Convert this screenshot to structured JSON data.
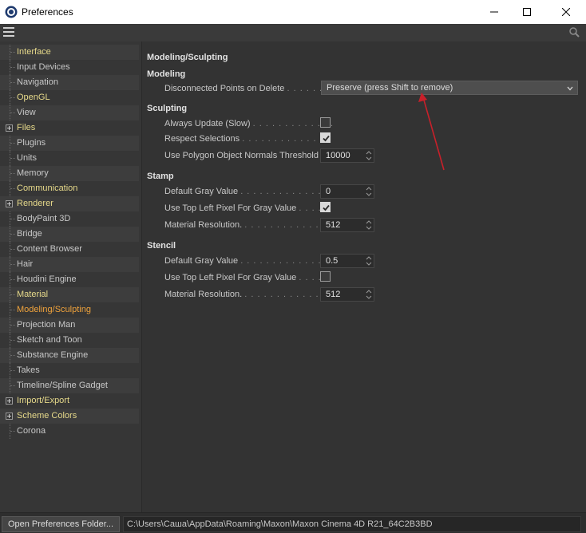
{
  "window": {
    "title": "Preferences"
  },
  "sidebar": {
    "items": [
      {
        "label": "Interface",
        "color": "yellow",
        "expandable": false
      },
      {
        "label": "Input Devices",
        "color": "gray",
        "expandable": false
      },
      {
        "label": "Navigation",
        "color": "gray",
        "expandable": false
      },
      {
        "label": "OpenGL",
        "color": "yellow",
        "expandable": false
      },
      {
        "label": "View",
        "color": "gray",
        "expandable": false
      },
      {
        "label": "Files",
        "color": "yellow",
        "expandable": true
      },
      {
        "label": "Plugins",
        "color": "gray",
        "expandable": false
      },
      {
        "label": "Units",
        "color": "gray",
        "expandable": false
      },
      {
        "label": "Memory",
        "color": "gray",
        "expandable": false
      },
      {
        "label": "Communication",
        "color": "yellow",
        "expandable": false
      },
      {
        "label": "Renderer",
        "color": "yellow",
        "expandable": true
      },
      {
        "label": "BodyPaint 3D",
        "color": "gray",
        "expandable": false
      },
      {
        "label": "Bridge",
        "color": "gray",
        "expandable": false
      },
      {
        "label": "Content Browser",
        "color": "gray",
        "expandable": false
      },
      {
        "label": "Hair",
        "color": "gray",
        "expandable": false
      },
      {
        "label": "Houdini Engine",
        "color": "gray",
        "expandable": false
      },
      {
        "label": "Material",
        "color": "yellow",
        "expandable": false
      },
      {
        "label": "Modeling/Sculpting",
        "color": "active",
        "expandable": false
      },
      {
        "label": "Projection Man",
        "color": "gray",
        "expandable": false
      },
      {
        "label": "Sketch and Toon",
        "color": "gray",
        "expandable": false
      },
      {
        "label": "Substance Engine",
        "color": "gray",
        "expandable": false
      },
      {
        "label": "Takes",
        "color": "gray",
        "expandable": false
      },
      {
        "label": "Timeline/Spline Gadget",
        "color": "gray",
        "expandable": false
      },
      {
        "label": "Import/Export",
        "color": "yellow",
        "expandable": true
      },
      {
        "label": "Scheme Colors",
        "color": "yellow",
        "expandable": true
      },
      {
        "label": "Corona",
        "color": "gray",
        "expandable": false
      }
    ]
  },
  "main": {
    "page_title": "Modeling/Sculpting",
    "modeling": {
      "title": "Modeling",
      "disconnected_label": "Disconnected Points on Delete",
      "disconnected_dots": ". . . . . .",
      "disconnected_value": "Preserve (press Shift to remove)"
    },
    "sculpting": {
      "title": "Sculpting",
      "always_update_label": "Always Update (Slow)",
      "always_update_dots": ". . . . . . . . . . . . .",
      "always_update_checked": false,
      "respect_selections_label": "Respect Selections",
      "respect_selections_dots": ". . . . . . . . . . . . . .",
      "respect_selections_checked": true,
      "normals_threshold_label": "Use Polygon Object Normals Threshold",
      "normals_threshold_value": "10000"
    },
    "stamp": {
      "title": "Stamp",
      "default_gray_label": "Default Gray Value",
      "default_gray_dots": ". . . . . . . . . . . . . . .",
      "default_gray_value": "0",
      "top_left_label": "Use Top Left Pixel For Gray Value",
      "top_left_dots": ". . . .",
      "top_left_checked": true,
      "resolution_label": "Material Resolution.",
      "resolution_dots": ". . . . . . . . . . . . . .",
      "resolution_value": "512"
    },
    "stencil": {
      "title": "Stencil",
      "default_gray_label": "Default Gray Value",
      "default_gray_dots": ". . . . . . . . . . . . . . .",
      "default_gray_value": "0.5",
      "top_left_label": "Use Top Left Pixel For Gray Value",
      "top_left_dots": ". . . .",
      "top_left_checked": false,
      "resolution_label": "Material Resolution.",
      "resolution_dots": ". . . . . . . . . . . . . .",
      "resolution_value": "512"
    }
  },
  "bottom": {
    "open_button": "Open Preferences Folder...",
    "path": "C:\\Users\\Саша\\AppData\\Roaming\\Maxon\\Maxon Cinema 4D R21_64C2B3BD"
  },
  "colors": {
    "active": "#f0a33c",
    "yellow": "#e6d98a",
    "annotation": "#c8202a"
  }
}
